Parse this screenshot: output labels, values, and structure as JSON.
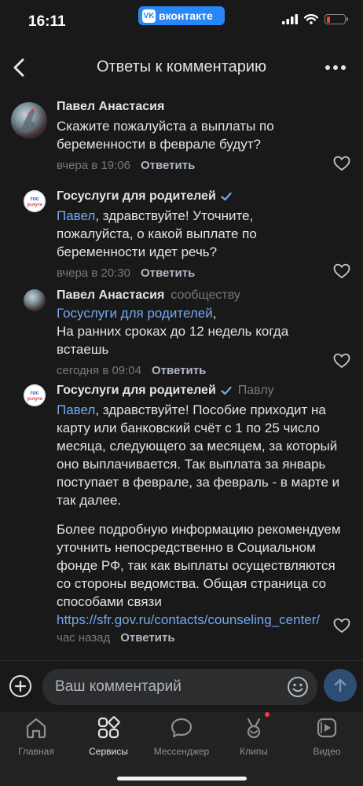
{
  "status_bar": {
    "time": "16:11",
    "app_pill": "вконтакте",
    "battery_level": 0.1
  },
  "header": {
    "title": "Ответы к комментарию"
  },
  "comments": [
    {
      "author": "Павел Анастасия",
      "text": "Скажите пожалуйста а выплаты по беременности в феврале будут?",
      "timestamp": "вчера в 19:06",
      "reply": "Ответить"
    },
    {
      "author": "Госуслуги для родителей",
      "verified": true,
      "avatar_text": "гос\nуслуги",
      "mention": "Павел",
      "text": ", здравствуйте! Уточните, пожалуйста, о какой выплате по беременности идет речь?",
      "timestamp": "вчера в 20:30",
      "reply": "Ответить"
    },
    {
      "author": "Павел Анастасия",
      "to": "сообществу",
      "mention": "Госуслуги для родителей",
      "text_after_mention": ",",
      "text": "На ранних сроках до 12 недель когда встаешь",
      "timestamp": "сегодня в 09:04",
      "reply": "Ответить"
    },
    {
      "author": "Госуслуги для родителей",
      "verified": true,
      "to": "Павлу",
      "mention": "Павел",
      "text": ", здравствуйте! Пособие приходит на карту или банковский счёт с 1 по 25 число месяца, следующего за месяцем, за который оно выплачивается. Так выплата за январь поступает в феврале, за февраль - в марте и так далее.",
      "text2": "Более подробную информацию рекомендуем уточнить непосредственно в Социальном фонде РФ, так как выплаты осуществляются со стороны ведомства. Общая страница со способами связи",
      "link": "https://sfr.gov.ru/contacts/counseling_center/",
      "timestamp": "час назад",
      "reply": "Ответить"
    }
  ],
  "composer": {
    "placeholder": "Ваш комментарий"
  },
  "tabbar": [
    {
      "label": "Главная",
      "icon": "home-icon"
    },
    {
      "label": "Сервисы",
      "icon": "services-icon",
      "active": true
    },
    {
      "label": "Мессенджер",
      "icon": "messenger-icon"
    },
    {
      "label": "Клипы",
      "icon": "clips-icon",
      "badge": true
    },
    {
      "label": "Видео",
      "icon": "video-icon"
    }
  ],
  "colors": {
    "background": "#19191a",
    "link": "#71aaeb",
    "accent": "#2787f5",
    "badge": "#ff3347"
  }
}
